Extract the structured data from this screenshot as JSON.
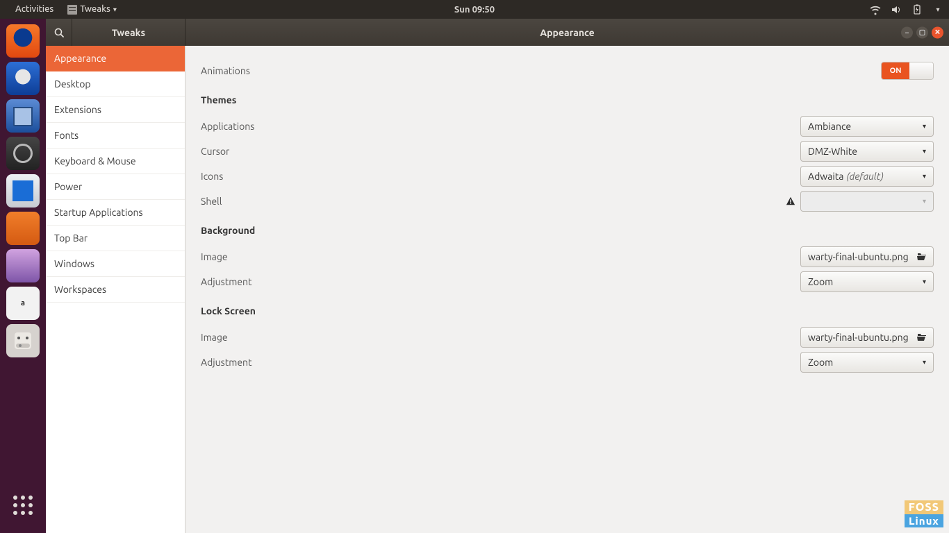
{
  "menubar": {
    "activities": "Activities",
    "app_menu": "Tweaks",
    "clock": "Sun 09:50"
  },
  "titlebar": {
    "sidebar_title": "Tweaks",
    "main_title": "Appearance"
  },
  "sidebar": {
    "items": [
      "Appearance",
      "Desktop",
      "Extensions",
      "Fonts",
      "Keyboard & Mouse",
      "Power",
      "Startup Applications",
      "Top Bar",
      "Windows",
      "Workspaces"
    ],
    "active_index": 0
  },
  "content": {
    "animations_label": "Animations",
    "animations_on": "ON",
    "themes_header": "Themes",
    "applications_label": "Applications",
    "applications_value": "Ambiance",
    "cursor_label": "Cursor",
    "cursor_value": "DMZ-White",
    "icons_label": "Icons",
    "icons_value": "Adwaita",
    "icons_suffix": "(default)",
    "shell_label": "Shell",
    "shell_value": "",
    "background_header": "Background",
    "bg_image_label": "Image",
    "bg_image_value": "warty-final-ubuntu.png",
    "bg_adjust_label": "Adjustment",
    "bg_adjust_value": "Zoom",
    "lock_header": "Lock Screen",
    "lk_image_label": "Image",
    "lk_image_value": "warty-final-ubuntu.png",
    "lk_adjust_label": "Adjustment",
    "lk_adjust_value": "Zoom"
  },
  "watermark": {
    "top": "FOSS",
    "bottom": "Linux"
  },
  "launcher": {
    "items": [
      "firefox",
      "thunderbird",
      "files",
      "rhythmbox",
      "libreoffice-writer",
      "ubuntu-software",
      "help",
      "amazon",
      "gnome-tweaks"
    ]
  }
}
